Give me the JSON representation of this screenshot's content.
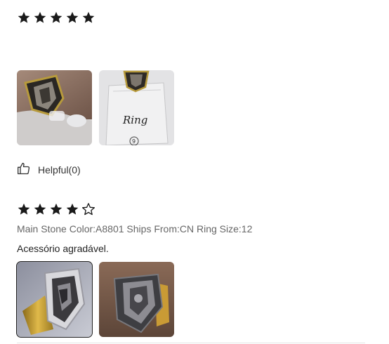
{
  "reviews": [
    {
      "stars": [
        1,
        1,
        1,
        1,
        1
      ],
      "images": [
        {
          "alt": "ring-photo-hand"
        },
        {
          "alt": "ring-photo-packaging",
          "label": "Ring",
          "tag": "9"
        }
      ],
      "helpful_label": "Helpful(0)"
    },
    {
      "stars": [
        1,
        1,
        1,
        1,
        0
      ],
      "attributes": "Main Stone Color:A8801 Ships From:CN Ring Size:12",
      "text": "Acessório agradável.",
      "images": [
        {
          "alt": "ring-photo-side"
        },
        {
          "alt": "ring-photo-worn"
        }
      ]
    }
  ],
  "colors": {
    "star_fill": "#1a1a1a",
    "meta_text": "#666666",
    "divider": "#e5e5e5"
  }
}
